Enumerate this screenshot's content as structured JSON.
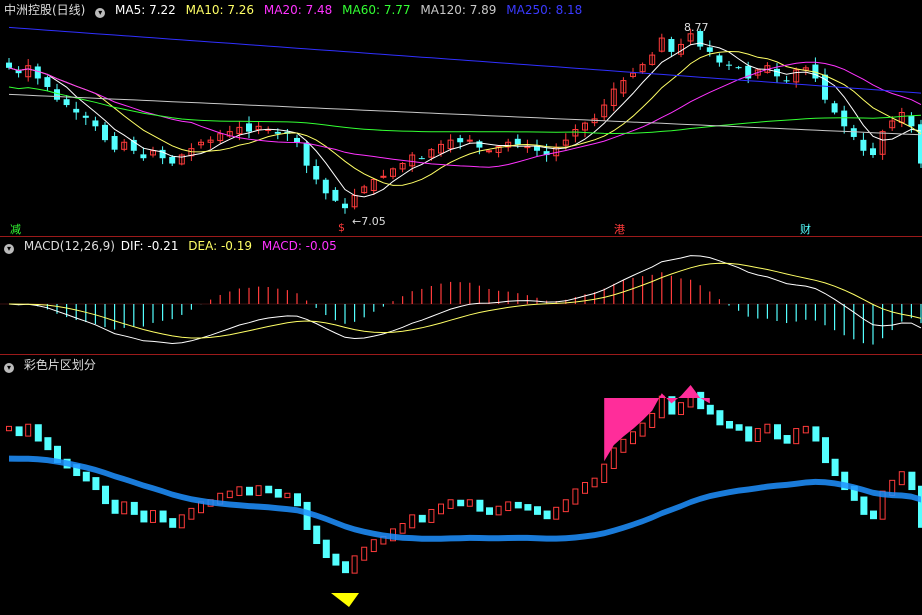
{
  "header": {
    "stock": "中洲控股(日线)",
    "ma5": "MA5: 7.22",
    "ma10": "MA10: 7.26",
    "ma20": "MA20: 7.48",
    "ma60": "MA60: 7.77",
    "ma120": "MA120: 7.89",
    "ma250": "MA250: 8.18"
  },
  "macd_header": {
    "name": "MACD(12,26,9)",
    "dif": "DIF: -0.21",
    "dea": "DEA: -0.19",
    "macd": "MACD: -0.05"
  },
  "band_header": {
    "name": "彩色片区划分"
  },
  "markers": {
    "jian": "减",
    "s": "$",
    "gang": "港",
    "cai": "财"
  },
  "annotations": {
    "low": "←7.05",
    "high": "8.77"
  },
  "colors": {
    "up": "#ff3b3b",
    "down": "#54ffff",
    "ma5": "#ffffff",
    "ma10": "#ffff66",
    "ma20": "#ff33ff",
    "ma60": "#33ff33",
    "ma120": "#c8c8c8",
    "ma250": "#3030ff",
    "band_top": "#ff2d9a",
    "band_line": "#1e90ff",
    "triangle": "#ffff00",
    "sep": "#9b1a1a"
  },
  "chart_data": {
    "type": "candlestick",
    "closes": [
      8.4,
      8.35,
      8.42,
      8.3,
      8.22,
      8.1,
      8.05,
      7.98,
      7.93,
      7.85,
      7.72,
      7.63,
      7.7,
      7.62,
      7.55,
      7.62,
      7.55,
      7.5,
      7.58,
      7.64,
      7.7,
      7.72,
      7.78,
      7.8,
      7.84,
      7.8,
      7.85,
      7.82,
      7.78,
      7.78,
      7.7,
      7.48,
      7.35,
      7.22,
      7.15,
      7.08,
      7.2,
      7.28,
      7.35,
      7.38,
      7.45,
      7.5,
      7.58,
      7.55,
      7.63,
      7.68,
      7.72,
      7.7,
      7.72,
      7.65,
      7.62,
      7.66,
      7.7,
      7.68,
      7.66,
      7.62,
      7.58,
      7.65,
      7.72,
      7.82,
      7.88,
      7.92,
      8.05,
      8.2,
      8.28,
      8.35,
      8.43,
      8.52,
      8.68,
      8.55,
      8.62,
      8.72,
      8.6,
      8.55,
      8.45,
      8.42,
      8.4,
      8.3,
      8.38,
      8.42,
      8.32,
      8.28,
      8.38,
      8.4,
      8.3,
      8.1,
      7.98,
      7.85,
      7.75,
      7.62,
      7.58,
      7.8,
      7.9,
      7.98,
      7.85,
      7.5
    ]
  }
}
